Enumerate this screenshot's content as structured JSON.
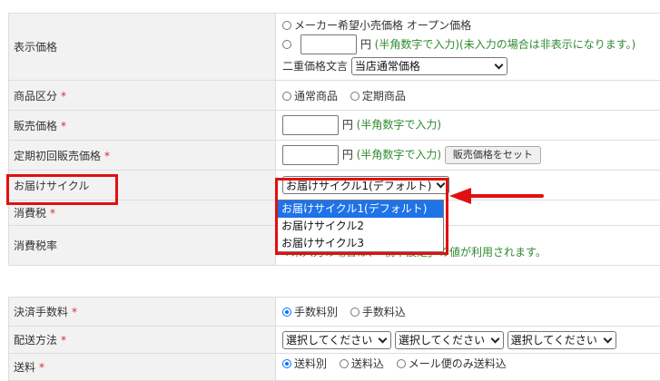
{
  "colors": {
    "required": "#d32f2f",
    "hint": "#2e8b2e",
    "highlight": "#e01010",
    "selected_option": "#1e73e8"
  },
  "display_price": {
    "label": "表示価格",
    "option_open": "メーカー希望小売価格 オープン価格",
    "yen": "円",
    "hint": "(半角数字で入力)(未入力の場合は非表示になります。)",
    "double_price_label": "二重価格文言",
    "double_price_value": "当店通常価格"
  },
  "product_type": {
    "label": "商品区分",
    "required_mark": "*",
    "options": [
      "通常商品",
      "定期商品"
    ]
  },
  "sale_price": {
    "label": "販売価格",
    "required_mark": "*",
    "yen": "円",
    "hint": "(半角数字で入力)"
  },
  "first_sub_price": {
    "label": "定期初回販売価格",
    "required_mark": "*",
    "yen": "円",
    "hint": "(半角数字で入力)",
    "set_button": "販売価格をセット"
  },
  "delivery_cycle": {
    "label": "お届けサイクル",
    "selected": "お届けサイクル1(デフォルト)",
    "options": [
      "お届けサイクル1(デフォルト)",
      "お届けサイクル2",
      "お届けサイクル3"
    ]
  },
  "tax": {
    "label": "消費税",
    "required_mark": "*"
  },
  "tax_rate": {
    "label": "消費税率",
    "note": "※未入力の場合は、「税率設定」の値が利用されます。"
  },
  "payment_fee": {
    "label": "決済手数料",
    "required_mark": "*",
    "options": [
      "手数料別",
      "手数料込"
    ]
  },
  "shipping_method": {
    "label": "配送方法",
    "required_mark": "*",
    "selects": [
      "選択してください",
      "選択してください",
      "選択してください"
    ]
  },
  "shipping_fee": {
    "label": "送料",
    "required_mark": "*",
    "options": [
      "送料別",
      "送料込",
      "メール便のみ送料込"
    ]
  }
}
